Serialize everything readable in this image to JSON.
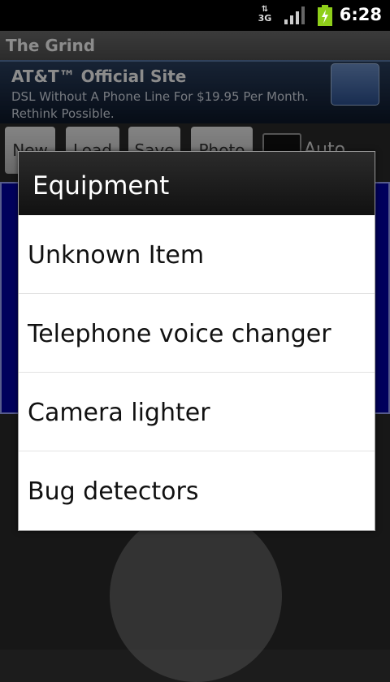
{
  "status_bar": {
    "network_type": "3G",
    "time": "6:28"
  },
  "app": {
    "title": "The Grind",
    "ad": {
      "headline": "AT&T™ Official Site",
      "body": "DSL Without A Phone Line For $19.95 Per Month. Rethink Possible."
    },
    "toolbar": {
      "buttons": [
        "New",
        "Load",
        "Save",
        "Photo"
      ],
      "auto_label": "Auto"
    }
  },
  "dialog": {
    "title": "Equipment",
    "items": [
      {
        "label": "Unknown Item"
      },
      {
        "label": "Telephone voice changer"
      },
      {
        "label": "Camera lighter"
      },
      {
        "label": "Bug detectors"
      }
    ]
  }
}
